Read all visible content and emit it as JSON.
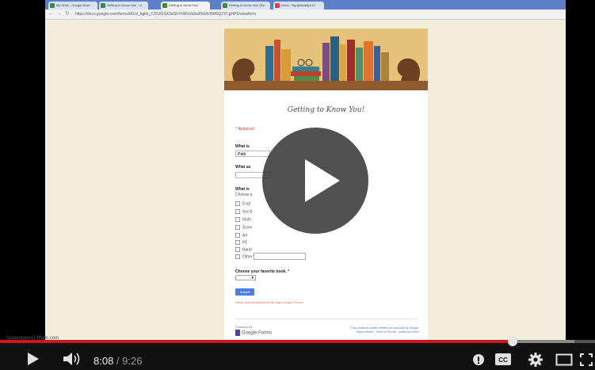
{
  "browser": {
    "tabs": [
      {
        "label": "My Drive - Google Drive"
      },
      {
        "label": "Getting to Know You! - G"
      },
      {
        "label": "Getting to Know You!"
      },
      {
        "label": "Getting to Know You! (Re"
      },
      {
        "label": "Inbox - tlsp@tenafly.k12"
      }
    ],
    "url": "https://docs.google.com/forms/d/1nl_bgkh_CX5JGSX3xGhYhWxVaSwf0dvh/9W6Q1YCgHPE/viewform"
  },
  "form": {
    "title": "Getting to Know You!",
    "required_note": "* Required",
    "q1_label": "What is",
    "q1_value": "Patti",
    "q2_label": "What sa",
    "q3_label": "What is",
    "q3_hint": "Choose a",
    "options": [
      "Engl",
      "Socia",
      "Math",
      "Scien",
      "Art",
      "PE",
      "Band",
      "Other:"
    ],
    "q4_label": "Choose your favorite book. *",
    "submit_label": "Submit",
    "never_note": "Never submit passwords through Google Forms.",
    "powered_by": "Powered by",
    "gforms_label": "Google Forms",
    "footer_right_1": "This content is neither created nor endorsed by Google.",
    "footer_right_2": "Report Abuse - Terms of Service - Additional Terms"
  },
  "player": {
    "current_time": "8:08",
    "separator": " / ",
    "duration": "9:26",
    "progress": 0.862,
    "buffered": 0.965,
    "watermark": "Screencast-O-Matic.com"
  },
  "colors": {
    "progress_red": "#cc181e",
    "page_bg": "#f3eddb",
    "banner_bg": "#e7c27a",
    "accent_blue": "#4d7fe0"
  },
  "icons": [
    "play-icon",
    "volume-icon",
    "youtube-icon",
    "captions-icon",
    "settings-icon",
    "theater-icon",
    "fullscreen-icon"
  ]
}
